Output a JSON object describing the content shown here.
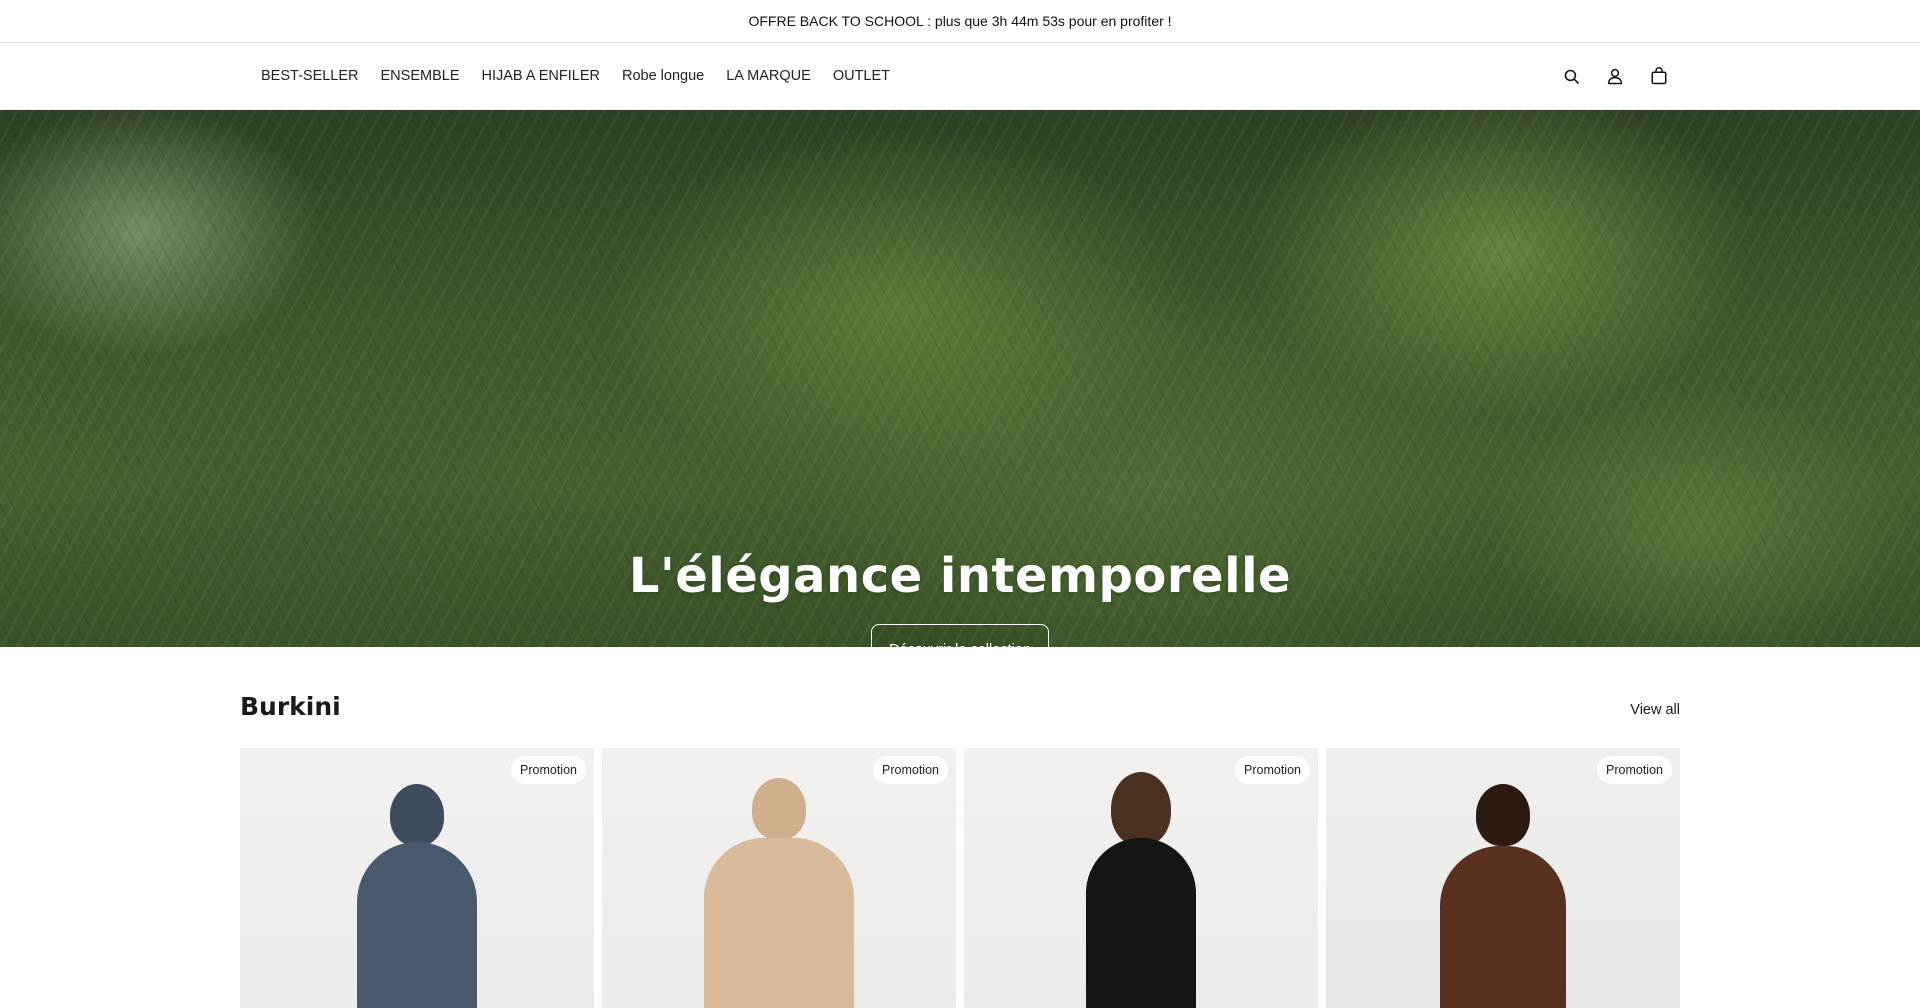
{
  "announcement": {
    "text": "OFFRE BACK TO SCHOOL : plus que 3h 44m 53s pour en profiter !"
  },
  "nav": {
    "items": [
      {
        "label": "BEST-SELLER"
      },
      {
        "label": "ENSEMBLE"
      },
      {
        "label": "HIJAB A ENFILER"
      },
      {
        "label": "Robe longue"
      },
      {
        "label": "LA MARQUE"
      },
      {
        "label": "OUTLET"
      }
    ],
    "icons": [
      "search-icon",
      "account-icon",
      "cart-icon"
    ]
  },
  "hero": {
    "title": "L'élégance intemporelle",
    "button_label": "Découvrir la collection"
  },
  "collection": {
    "title": "Burkini",
    "view_all_label": "View all",
    "products": [
      {
        "badge": "Promotion",
        "color": "#4a5a6e",
        "head_color": "#3e4c5e",
        "skin": "#4a3022"
      },
      {
        "badge": "Promotion",
        "color": "#d8b99a",
        "head_color": "#cfae8c",
        "skin": "#3a2418"
      },
      {
        "badge": "Promotion",
        "color": "#151515",
        "head_color": "#4a3120",
        "skin": "#c79a7c"
      },
      {
        "badge": "Promotion",
        "color": "#5a3020",
        "head_color": "#2a1a12",
        "skin": "#8a5a40"
      }
    ]
  }
}
